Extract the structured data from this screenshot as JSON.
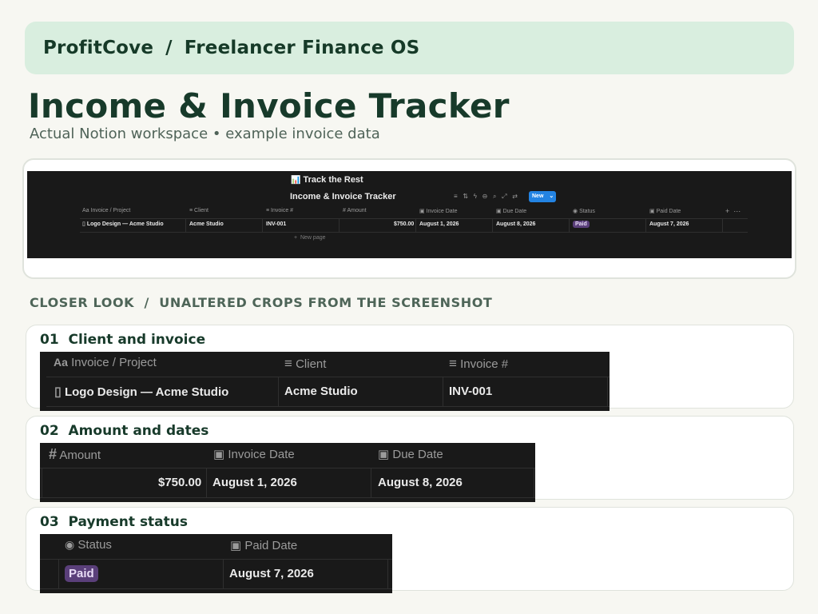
{
  "header": {
    "brand": "ProfitCove",
    "separator": "/",
    "product": "Freelancer Finance OS"
  },
  "page": {
    "title": "Income & Invoice Tracker",
    "subtitle": "Actual Notion workspace • example invoice data"
  },
  "notion": {
    "page_icon": "📊",
    "page_name": "Track the Rest",
    "database_title": "Income & Invoice Tracker",
    "new_button": "New",
    "add_page": "New page",
    "columns": [
      "Invoice / Project",
      "Client",
      "Invoice #",
      "Amount",
      "Invoice Date",
      "Due Date",
      "Status",
      "Paid Date"
    ],
    "row": {
      "project": "Logo Design — Acme Studio",
      "client": "Acme Studio",
      "invoice_no": "INV-001",
      "amount": "$750.00",
      "invoice_date": "August 1, 2026",
      "due_date": "August 8, 2026",
      "status": "Paid",
      "paid_date": "August 7, 2026"
    },
    "status_color": "#5a3f7a"
  },
  "closer_look": {
    "label": "CLOSER LOOK  /  UNALTERED CROPS FROM THE SCREENSHOT",
    "crops": [
      {
        "number": "01",
        "title": "Client and invoice"
      },
      {
        "number": "02",
        "title": "Amount and dates"
      },
      {
        "number": "03",
        "title": "Payment status"
      }
    ]
  },
  "colors": {
    "brand_bar": "#d9eedf",
    "accent_text": "#173a2a",
    "new_button": "#2383e2"
  }
}
